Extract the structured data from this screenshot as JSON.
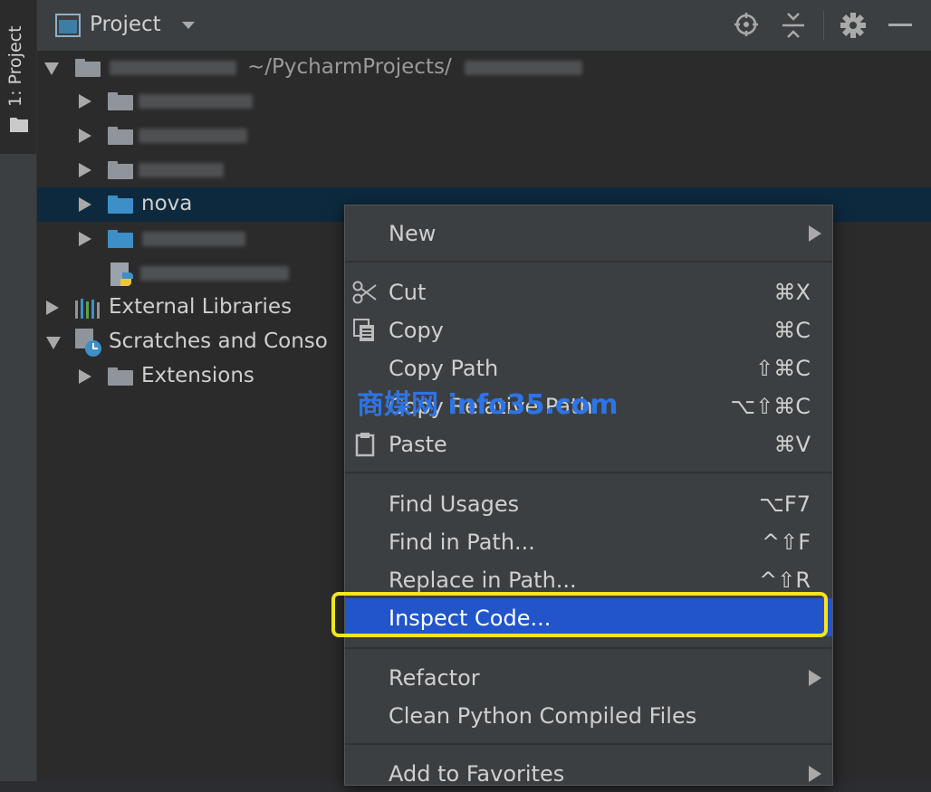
{
  "side_tab": {
    "label": "1: Project"
  },
  "header": {
    "title": "Project"
  },
  "tree": {
    "root_path": "~/PycharmProjects/",
    "items": {
      "nova": "nova",
      "external_libraries": "External Libraries",
      "scratches": "Scratches and Conso",
      "extensions": "Extensions"
    }
  },
  "menu": {
    "new": "New",
    "cut": {
      "label": "Cut",
      "shortcut": "⌘X"
    },
    "copy": {
      "label": "Copy",
      "shortcut": "⌘C"
    },
    "copy_path": {
      "label": "Copy Path",
      "shortcut": "⇧⌘C"
    },
    "copy_relative_path": {
      "label": "Copy Relative Path",
      "shortcut": "⌥⇧⌘C"
    },
    "paste": {
      "label": "Paste",
      "shortcut": "⌘V"
    },
    "find_usages": {
      "label": "Find Usages",
      "shortcut": "⌥F7"
    },
    "find_in_path": {
      "label": "Find in Path...",
      "shortcut": "^⇧F"
    },
    "replace_in_path": {
      "label": "Replace in Path...",
      "shortcut": "^⇧R"
    },
    "inspect_code": {
      "label": "Inspect Code..."
    },
    "refactor": "Refactor",
    "clean_python": "Clean Python Compiled Files",
    "add_to_favorites": "Add to Favorites"
  },
  "watermark": "商媒网 info35.com",
  "colors": {
    "menu_highlight": "#2155c9",
    "focus_ring": "#f2e521",
    "selected_row": "#0d293e",
    "folder_blue": "#3d8fc7"
  }
}
